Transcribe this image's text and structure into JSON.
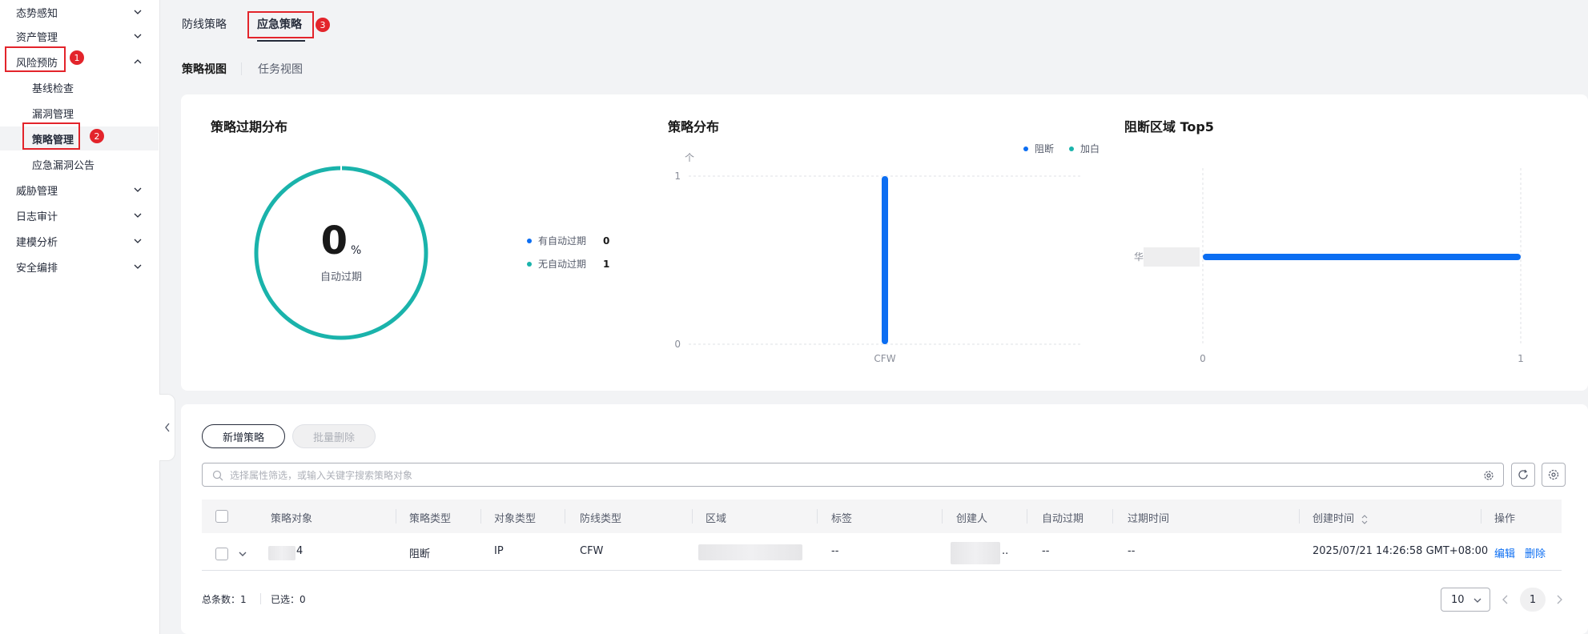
{
  "sidebar": {
    "items": [
      {
        "label": "态势感知",
        "expanded": false
      },
      {
        "label": "资产管理",
        "expanded": false
      },
      {
        "label": "风险预防",
        "expanded": true
      },
      {
        "label": "基线检查"
      },
      {
        "label": "漏洞管理"
      },
      {
        "label": "策略管理",
        "active": true
      },
      {
        "label": "应急漏洞公告"
      },
      {
        "label": "威胁管理",
        "expanded": false
      },
      {
        "label": "日志审计",
        "expanded": false
      },
      {
        "label": "建模分析",
        "expanded": false
      },
      {
        "label": "安全编排",
        "expanded": false
      }
    ]
  },
  "annotations": {
    "step1": "1",
    "step2": "2",
    "step3": "3"
  },
  "tabs": [
    {
      "label": "防线策略"
    },
    {
      "label": "应急策略",
      "active": true
    }
  ],
  "subtabs": [
    {
      "label": "策略视图",
      "active": true
    },
    {
      "label": "任务视图"
    }
  ],
  "charts": {
    "expiry": {
      "title": "策略过期分布",
      "center_value": "0",
      "center_unit": "%",
      "center_label": "自动过期",
      "legend": [
        {
          "label": "有自动过期",
          "value": "0",
          "color": "#0c6ef2"
        },
        {
          "label": "无自动过期",
          "value": "1",
          "color": "#1ab3ab"
        }
      ]
    },
    "distribution": {
      "title": "策略分布",
      "unit": "个",
      "legend": [
        {
          "label": "阻断",
          "color": "#0c6ef2"
        },
        {
          "label": "加白",
          "color": "#1ab3ab"
        }
      ]
    },
    "top5": {
      "title": "阻断区域 Top5",
      "category_prefix": "华"
    }
  },
  "chart_data": [
    {
      "type": "pie",
      "title": "策略过期分布",
      "categories": [
        "有自动过期",
        "无自动过期"
      ],
      "values": [
        0,
        1
      ]
    },
    {
      "type": "bar",
      "title": "策略分布",
      "ylabel": "个",
      "categories": [
        "CFW"
      ],
      "series": [
        {
          "name": "阻断",
          "values": [
            1
          ]
        },
        {
          "name": "加白",
          "values": [
            0
          ]
        }
      ],
      "ylim": [
        0,
        1
      ],
      "yticks": [
        "0",
        "1"
      ]
    },
    {
      "type": "bar",
      "orientation": "horizontal",
      "title": "阻断区域 Top5",
      "categories": [
        "华"
      ],
      "values": [
        1
      ],
      "xlim": [
        0,
        1
      ],
      "xticks": [
        "0",
        "1"
      ]
    }
  ],
  "toolbar": {
    "add_label": "新增策略",
    "batch_delete_label": "批量删除",
    "search_placeholder": "选择属性筛选，或输入关键字搜索策略对象"
  },
  "table": {
    "columns": [
      "策略对象",
      "策略类型",
      "对象类型",
      "防线类型",
      "区域",
      "标签",
      "创建人",
      "自动过期",
      "过期时间",
      "创建时间",
      "操作"
    ],
    "rows": [
      {
        "object": "4",
        "policy_type": "阻断",
        "object_type": "IP",
        "defense_type": "CFW",
        "tag": "--",
        "creator_suffix": "..",
        "auto_expire": "--",
        "expire_time": "--",
        "created_at": "2025/07/21 14:26:58 GMT+08:00",
        "actions": [
          "编辑",
          "删除"
        ]
      }
    ]
  },
  "footer": {
    "total_label": "总条数：",
    "total": "1",
    "selected_label": "已选：",
    "selected": "0",
    "page_size": "10",
    "page": "1"
  }
}
